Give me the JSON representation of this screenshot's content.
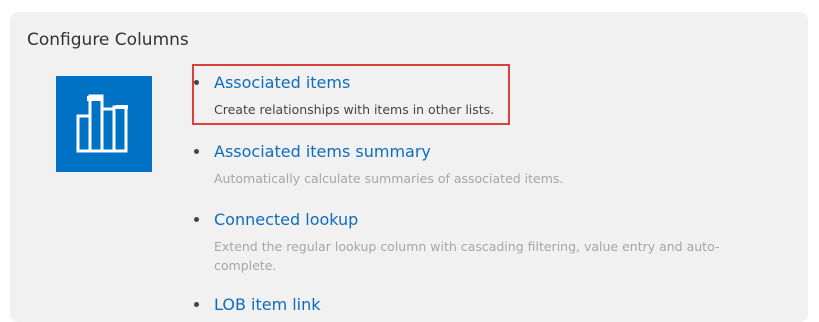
{
  "panel": {
    "title": "Configure Columns"
  },
  "tile": {
    "icon": "columns-icon",
    "background_color": "#0072c6"
  },
  "options": [
    {
      "label": "Associated items",
      "description": "Create relationships with items in other lists.",
      "highlighted": true
    },
    {
      "label": "Associated items summary",
      "description": "Automatically calculate summaries of associated items."
    },
    {
      "label": "Connected lookup",
      "description": "Extend the regular lookup column with cascading filtering, value entry and auto-complete."
    },
    {
      "label": "LOB item link",
      "description": ""
    }
  ],
  "colors": {
    "link": "#0f6cbd",
    "highlight_border": "#d9413f",
    "panel_background": "#f1f1f1"
  }
}
